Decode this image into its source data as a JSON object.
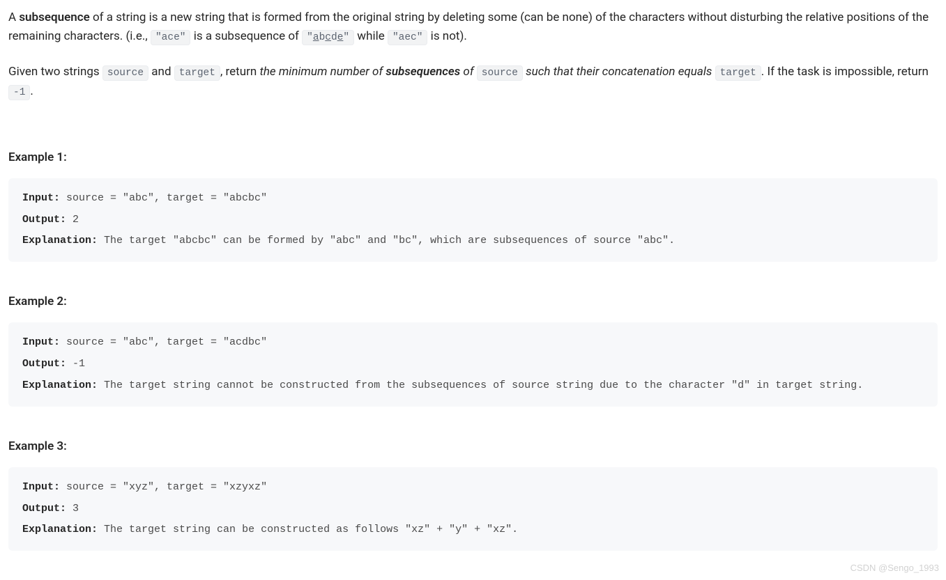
{
  "intro": {
    "p1_parts": {
      "t1": "A ",
      "b1": "subsequence",
      "t2": " of a string is a new string that is formed from the original string by deleting some (can be none) of the characters without disturbing the relative positions of the remaining characters. (i.e., ",
      "c1_html": "\"ace\"",
      "t3": " is a subsequence of ",
      "c2_plain_a": "\"",
      "c2_u1": "a",
      "c2_plain_b": "b",
      "c2_u2": "c",
      "c2_plain_c": "d",
      "c2_u3": "e",
      "c2_plain_d": "\"",
      "t4": " while ",
      "c3_html": "\"aec\"",
      "t5": " is not)."
    },
    "p2_parts": {
      "t1": "Given two strings ",
      "c1": "source",
      "t2": " and ",
      "c2": "target",
      "t3": ", return ",
      "i1": "the minimum number of ",
      "ib1": "subsequences",
      "i2": " of ",
      "c3": "source",
      "i3": " such that their concatenation equals ",
      "c4": "target",
      "t4": ". If the task is impossible, return ",
      "c5": "-1",
      "t5": "."
    }
  },
  "labels": {
    "input": "Input:",
    "output": "Output:",
    "explanation": "Explanation:"
  },
  "examples": [
    {
      "heading": "Example 1:",
      "input": " source = \"abc\", target = \"abcbc\"",
      "output": " 2",
      "explanation": " The target \"abcbc\" can be formed by \"abc\" and \"bc\", which are subsequences of source \"abc\"."
    },
    {
      "heading": "Example 2:",
      "input": " source = \"abc\", target = \"acdbc\"",
      "output": " -1",
      "explanation": " The target string cannot be constructed from the subsequences of source string due to the character \"d\" in target string."
    },
    {
      "heading": "Example 3:",
      "input": " source = \"xyz\", target = \"xzyxz\"",
      "output": " 3",
      "explanation": " The target string can be constructed as follows \"xz\" + \"y\" + \"xz\"."
    }
  ],
  "watermark": "CSDN @Sengo_1993"
}
